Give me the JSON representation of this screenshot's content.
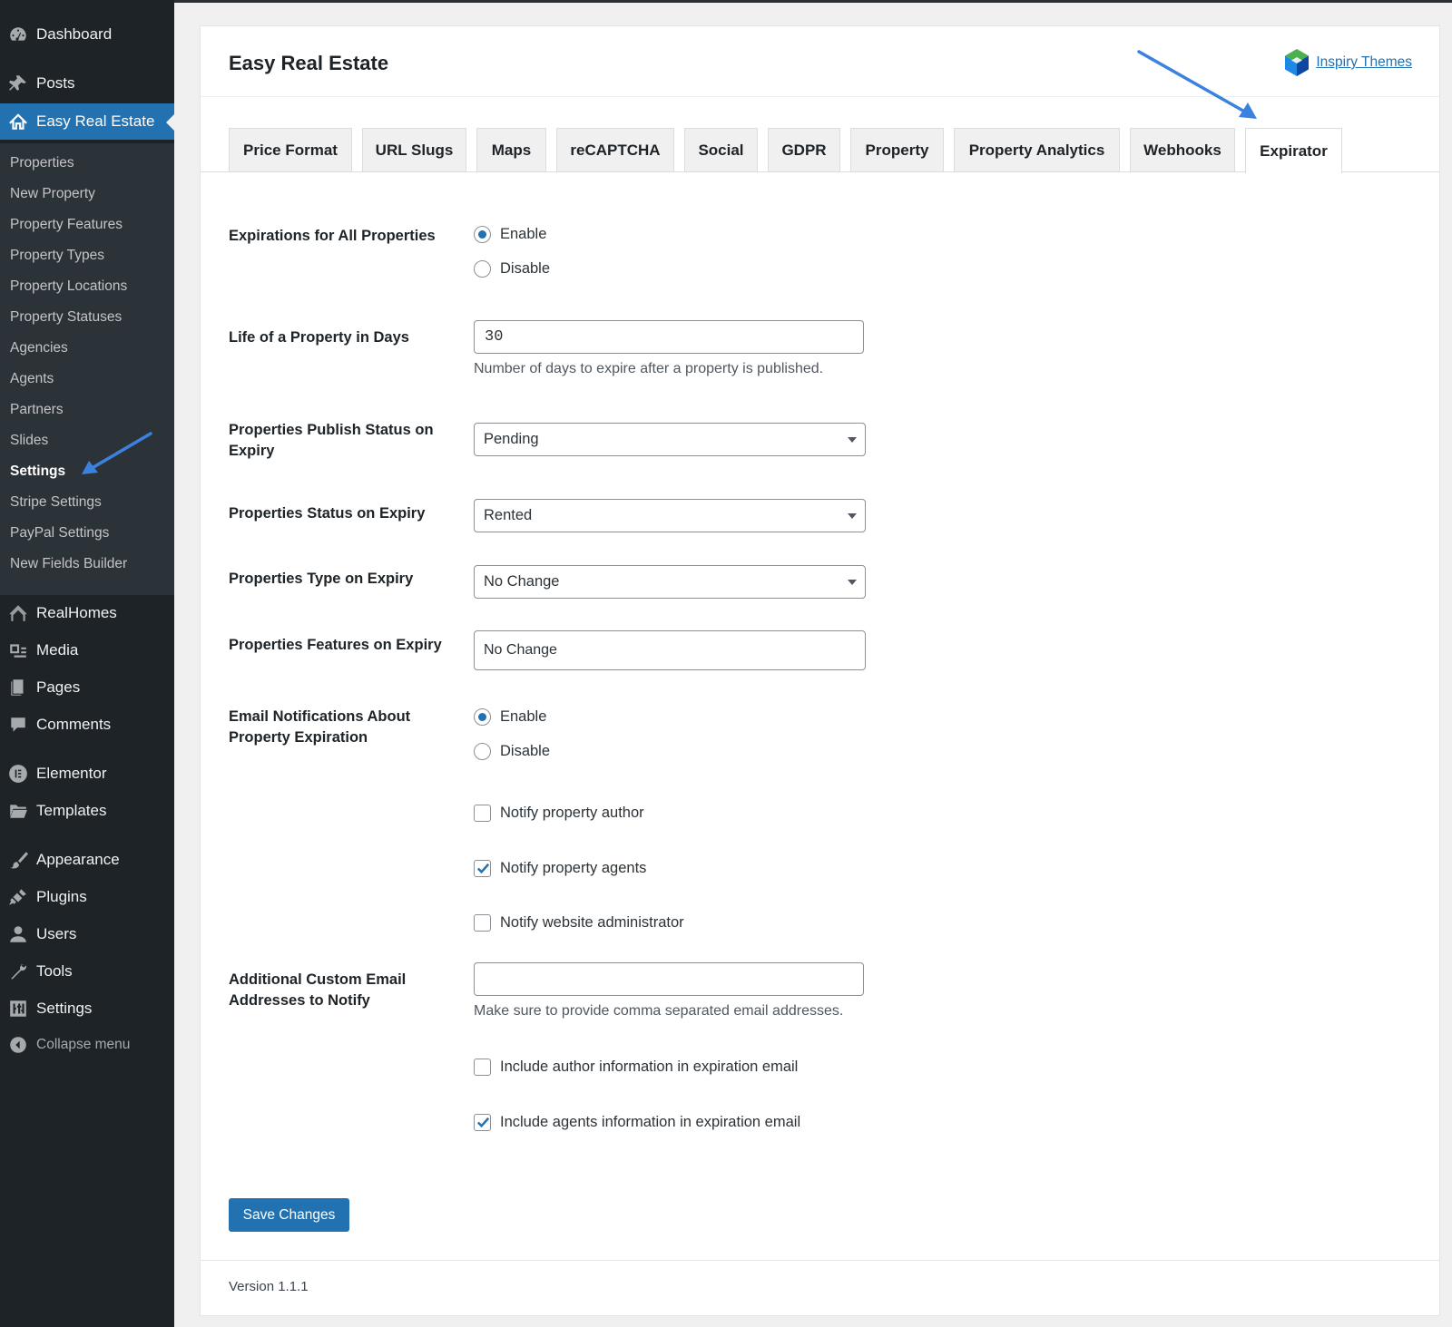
{
  "sidebar": {
    "top_items": [
      {
        "label": "Dashboard",
        "icon": "dashboard-icon"
      },
      {
        "label": "Posts",
        "icon": "pin-icon"
      },
      {
        "label": "Easy Real Estate",
        "icon": "house-icon"
      }
    ],
    "submenu": [
      "Properties",
      "New Property",
      "Property Features",
      "Property Types",
      "Property Locations",
      "Property Statuses",
      "Agencies",
      "Agents",
      "Partners",
      "Slides",
      "Settings",
      "Stripe Settings",
      "PayPal Settings",
      "New Fields Builder"
    ],
    "current_submenu": "Settings",
    "bottom_items": [
      {
        "label": "RealHomes",
        "icon": "realhomes-icon"
      },
      {
        "label": "Media",
        "icon": "media-icon"
      },
      {
        "label": "Pages",
        "icon": "pages-icon"
      },
      {
        "label": "Comments",
        "icon": "comments-icon"
      },
      {
        "label": "Elementor",
        "icon": "elementor-icon"
      },
      {
        "label": "Templates",
        "icon": "folder-icon"
      },
      {
        "label": "Appearance",
        "icon": "brush-icon"
      },
      {
        "label": "Plugins",
        "icon": "plug-icon"
      },
      {
        "label": "Users",
        "icon": "user-icon"
      },
      {
        "label": "Tools",
        "icon": "wrench-icon"
      },
      {
        "label": "Settings",
        "icon": "sliders-icon"
      }
    ],
    "collapse_label": "Collapse menu"
  },
  "header": {
    "title": "Easy Real Estate",
    "brand_link": "Inspiry Themes"
  },
  "tabs": [
    "Price Format",
    "URL Slugs",
    "Maps",
    "reCAPTCHA",
    "Social",
    "GDPR",
    "Property",
    "Property Analytics",
    "Webhooks",
    "Expirator"
  ],
  "active_tab": "Expirator",
  "form": {
    "expirations": {
      "label": "Expirations for All Properties",
      "options": [
        "Enable",
        "Disable"
      ],
      "selected": "Enable"
    },
    "life_days": {
      "label": "Life of a Property in Days",
      "value": "30",
      "help": "Number of days to expire after a property is published."
    },
    "publish_status": {
      "label": "Properties Publish Status on Expiry",
      "value": "Pending"
    },
    "status_on_expiry": {
      "label": "Properties Status on Expiry",
      "value": "Rented"
    },
    "type_on_expiry": {
      "label": "Properties Type on Expiry",
      "value": "No Change"
    },
    "features_on_expiry": {
      "label": "Properties Features on Expiry",
      "value": "No Change"
    },
    "email_notifications": {
      "label": "Email Notifications About Property Expiration",
      "options": [
        "Enable",
        "Disable"
      ],
      "selected": "Enable"
    },
    "notify": [
      {
        "label": "Notify property author",
        "checked": false
      },
      {
        "label": "Notify property agents",
        "checked": true
      },
      {
        "label": "Notify website administrator",
        "checked": false
      }
    ],
    "custom_emails": {
      "label": "Additional Custom Email Addresses to Notify",
      "value": "",
      "help": "Make sure to provide comma separated email addresses."
    },
    "include": [
      {
        "label": "Include author information in expiration email",
        "checked": false
      },
      {
        "label": "Include agents information in expiration email",
        "checked": true
      }
    ],
    "save_label": "Save Changes"
  },
  "footer": {
    "version": "Version 1.1.1"
  },
  "colors": {
    "accent": "#2271b1",
    "sidebar_bg": "#1d2327",
    "submenu_bg": "#2c3338",
    "annotation_arrow": "#3b82e0"
  }
}
